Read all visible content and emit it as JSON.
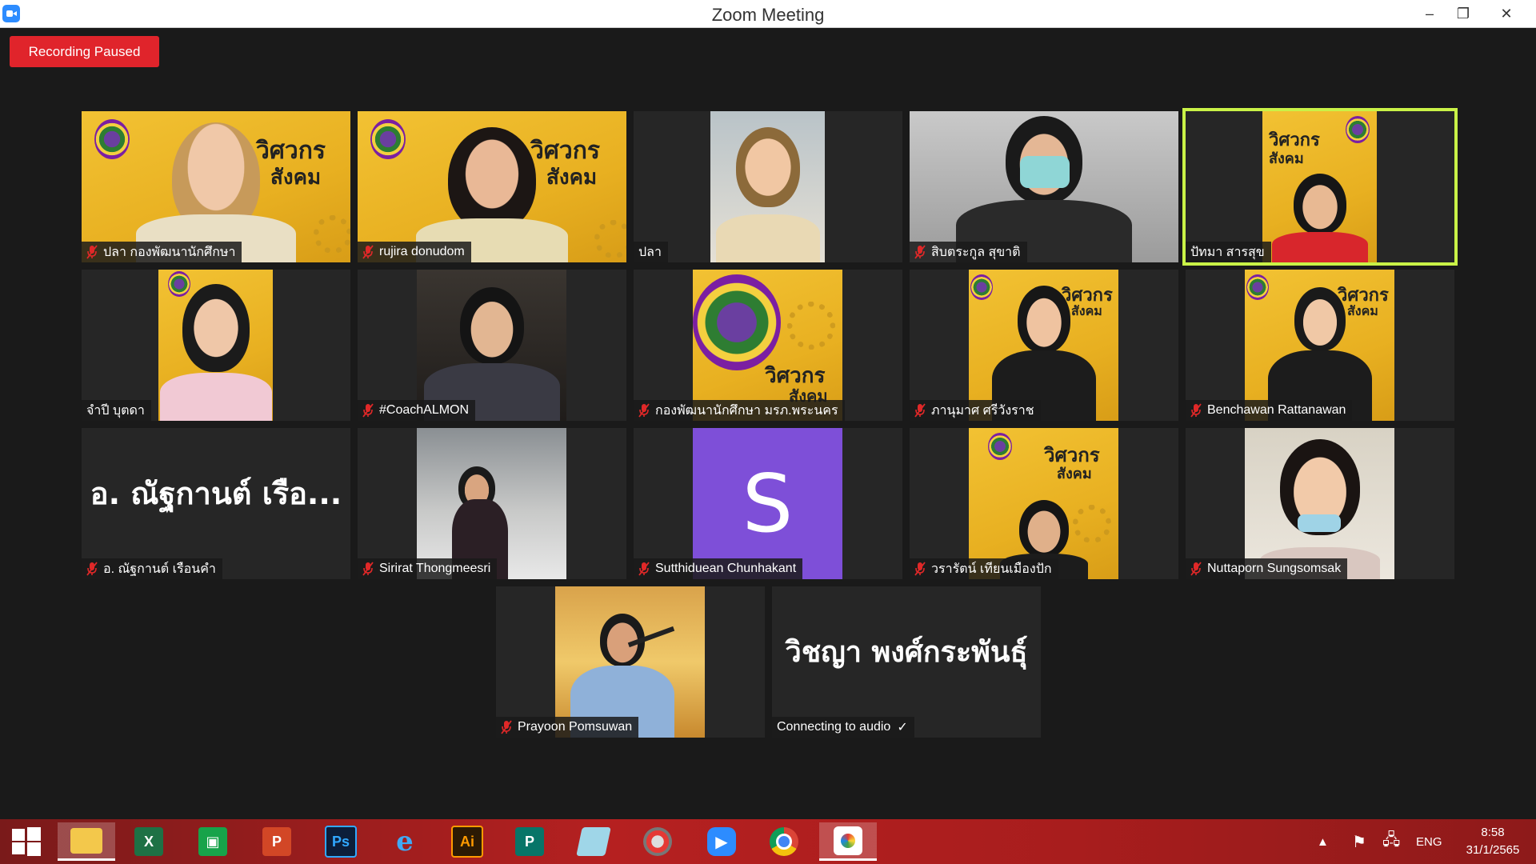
{
  "window": {
    "title": "Zoom Meeting",
    "minimize_glyph": "–",
    "restore_glyph": "❐",
    "close_glyph": "✕"
  },
  "recording": {
    "label": "Recording Paused"
  },
  "participants": [
    {
      "name": "ปลา กองพัฒนานักศึกษา",
      "muted": true
    },
    {
      "name": "rujira donudom",
      "muted": true
    },
    {
      "name": "ปลา",
      "muted": false
    },
    {
      "name": "สิบตระกูล สุขาติ",
      "muted": true
    },
    {
      "name": "ปัทมา สารสุข",
      "muted": false,
      "active_speaker": true
    },
    {
      "name": "จำปี บุตดา",
      "muted": false
    },
    {
      "name": "#CoachALMON",
      "muted": true
    },
    {
      "name": "กองพัฒนานักศึกษา มรภ.พระนคร",
      "muted": true
    },
    {
      "name": "ภานุมาศ ศรีวังราช",
      "muted": true
    },
    {
      "name": "Benchawan Rattanawan",
      "muted": true
    },
    {
      "name": "อ. ณัฐกานต์  เรือนคำ",
      "muted": true,
      "display_text": "อ. ณัฐกานต์  เรือ..."
    },
    {
      "name": "Sirirat Thongmeesri",
      "muted": true
    },
    {
      "name": "Sutthiduean Chunhakant",
      "muted": true,
      "avatar_initial": "S"
    },
    {
      "name": "วรารัตน์ เทียนเมืองปัก",
      "muted": true
    },
    {
      "name": "Nuttaporn Sungsomsak",
      "muted": true
    },
    {
      "name": "Prayoon Pomsuwan",
      "muted": true
    },
    {
      "name": "Connecting to audio",
      "muted": false,
      "display_text": "วิชญา พงศ์กระพันธุ์",
      "status_icon": "checkmark-icon"
    }
  ],
  "banner": {
    "line1": "วิศวกร",
    "line2": "สังคม"
  },
  "taskbar": {
    "apps": [
      "start",
      "file-explorer",
      "excel",
      "store",
      "powerpoint",
      "photoshop",
      "internet-explorer",
      "illustrator",
      "publisher",
      "notepad",
      "photoscape",
      "zoom",
      "chrome",
      "paint"
    ],
    "labels": {
      "excel": "X",
      "powerpoint": "P",
      "photoshop": "Ps",
      "illustrator": "Ai",
      "publisher": "P"
    },
    "language": "ENG",
    "time": "8:58",
    "date": "31/1/2565"
  }
}
